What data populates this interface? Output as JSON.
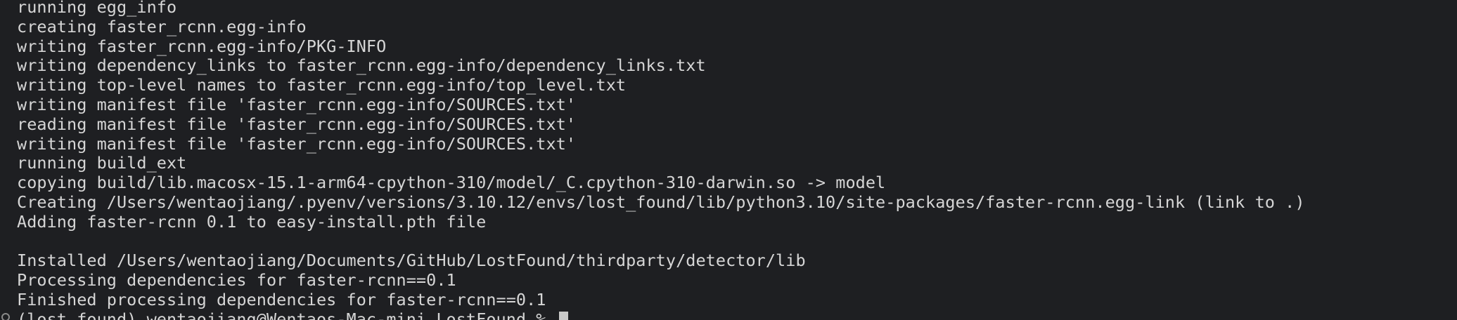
{
  "terminal": {
    "output_lines": [
      "running egg_info",
      "creating faster_rcnn.egg-info",
      "writing faster_rcnn.egg-info/PKG-INFO",
      "writing dependency_links to faster_rcnn.egg-info/dependency_links.txt",
      "writing top-level names to faster_rcnn.egg-info/top_level.txt",
      "writing manifest file 'faster_rcnn.egg-info/SOURCES.txt'",
      "reading manifest file 'faster_rcnn.egg-info/SOURCES.txt'",
      "writing manifest file 'faster_rcnn.egg-info/SOURCES.txt'",
      "running build_ext",
      "copying build/lib.macosx-15.1-arm64-cpython-310/model/_C.cpython-310-darwin.so -> model",
      "Creating /Users/wentaojiang/.pyenv/versions/3.10.12/envs/lost_found/lib/python3.10/site-packages/faster-rcnn.egg-link (link to .)",
      "Adding faster-rcnn 0.1 to easy-install.pth file",
      "",
      "Installed /Users/wentaojiang/Documents/GitHub/LostFound/thirdparty/detector/lib",
      "Processing dependencies for faster-rcnn==0.1",
      "Finished processing dependencies for faster-rcnn==0.1"
    ],
    "prompt": "(lost_found) wentaojiang@Wentaos-Mac-mini LostFound % ",
    "colors": {
      "background": "#1e1f22",
      "text": "#d6d6d6",
      "cursor": "#c9c9c9"
    }
  }
}
